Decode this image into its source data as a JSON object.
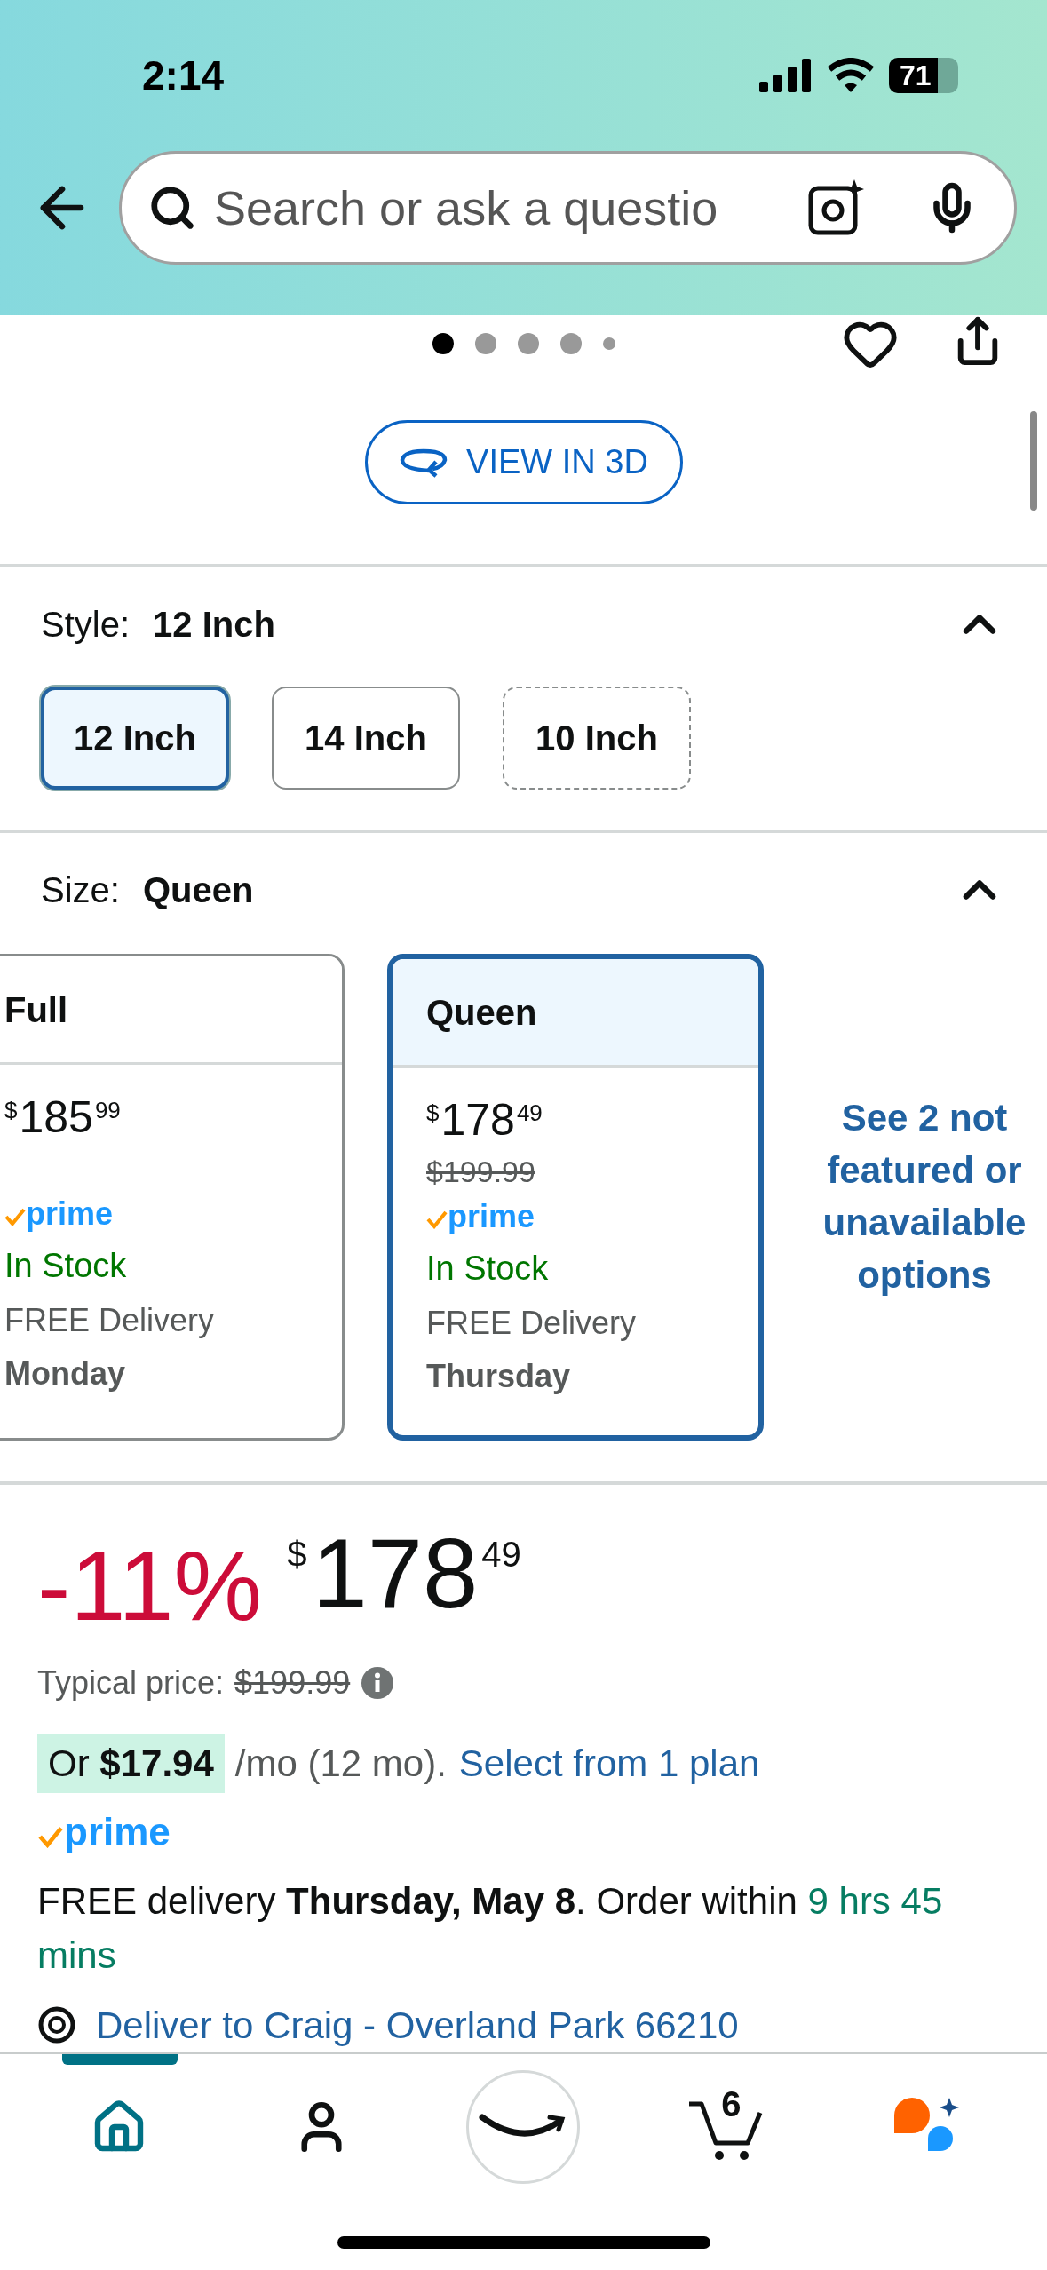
{
  "status_bar": {
    "time": "2:14",
    "battery": "71"
  },
  "search": {
    "placeholder": "Search or ask a questio"
  },
  "carousel": {
    "dots": [
      {
        "selected": true
      },
      {
        "selected": false
      },
      {
        "selected": false
      },
      {
        "selected": false
      },
      {
        "selected": false
      }
    ]
  },
  "view_3d_button": "VIEW IN 3D",
  "style": {
    "label": "Style:",
    "value": "12 Inch",
    "expanded": true,
    "options": [
      {
        "label": "12 Inch",
        "selected": true,
        "available": true
      },
      {
        "label": "14 Inch",
        "selected": false,
        "available": true
      },
      {
        "label": "10 Inch",
        "selected": false,
        "available": false
      }
    ]
  },
  "size": {
    "label": "Size:",
    "value": "Queen",
    "expanded": true,
    "options": [
      {
        "name": "Full",
        "selected": false,
        "price": {
          "symbol": "$",
          "whole": "185",
          "fraction": "99"
        },
        "prime": "prime",
        "stock": "In Stock",
        "delivery": "FREE Delivery",
        "day": "Monday"
      },
      {
        "name": "Queen",
        "selected": true,
        "price": {
          "symbol": "$",
          "whole": "178",
          "fraction": "49"
        },
        "list_price": "$199.99",
        "prime": "prime",
        "stock": "In Stock",
        "delivery": "FREE Delivery",
        "day": "Thursday"
      }
    ],
    "more_link": "See 2 not featured or unavailable options"
  },
  "buy_box": {
    "discount": "-11%",
    "price": {
      "symbol": "$",
      "whole": "178",
      "fraction": "49"
    },
    "typical_label": "Typical price:",
    "typical_value": "$199.99",
    "installment": {
      "prefix": "Or",
      "amount": "$17.94",
      "suffix": "/mo (12 mo).",
      "link": "Select from 1 plan"
    },
    "prime": "prime",
    "delivery": "FREE delivery **Thursday, May 8**. Order within",
    "countdown": "9 hrs 45 mins",
    "deliver_to": "Deliver to Craig - Overland Park 66210"
  },
  "nav": [
    {
      "kind": "home",
      "selected": true
    },
    {
      "kind": "account",
      "selected": false
    },
    {
      "kind": "logo",
      "selected": false
    },
    {
      "kind": "cart",
      "selected": false,
      "badge": "6"
    },
    {
      "kind": "assistant",
      "selected": false
    }
  ]
}
